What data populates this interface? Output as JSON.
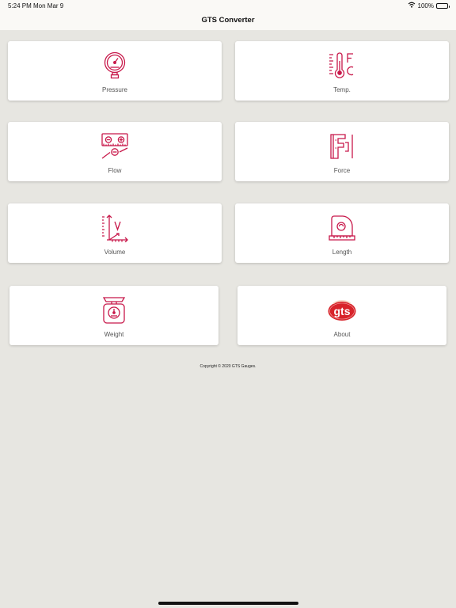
{
  "status_bar": {
    "time": "5:24 PM",
    "date": "Mon Mar 9",
    "battery": "100%"
  },
  "nav": {
    "title": "GTS Converter"
  },
  "cards": {
    "pressure": {
      "label": "Pressure",
      "icon": "pressure-gauge-icon"
    },
    "temp": {
      "label": "Temp.",
      "icon": "thermometer-icon"
    },
    "flow": {
      "label": "Flow",
      "icon": "flow-meter-icon"
    },
    "force": {
      "label": "Force",
      "icon": "force-icon"
    },
    "volume": {
      "label": "Volume",
      "icon": "volume-icon"
    },
    "length": {
      "label": "Length",
      "icon": "tape-measure-icon"
    },
    "weight": {
      "label": "Weight",
      "icon": "scale-icon"
    },
    "about": {
      "label": "About",
      "icon": "gts-logo",
      "logo_text": "gts"
    }
  },
  "footer": {
    "copyright": "Copyright © 2020 GTS Gauges."
  },
  "colors": {
    "accent": "#c8184a",
    "background": "#e7e6e1",
    "bar": "#faf9f6",
    "card": "#ffffff",
    "logo_red": "#d8232a"
  }
}
